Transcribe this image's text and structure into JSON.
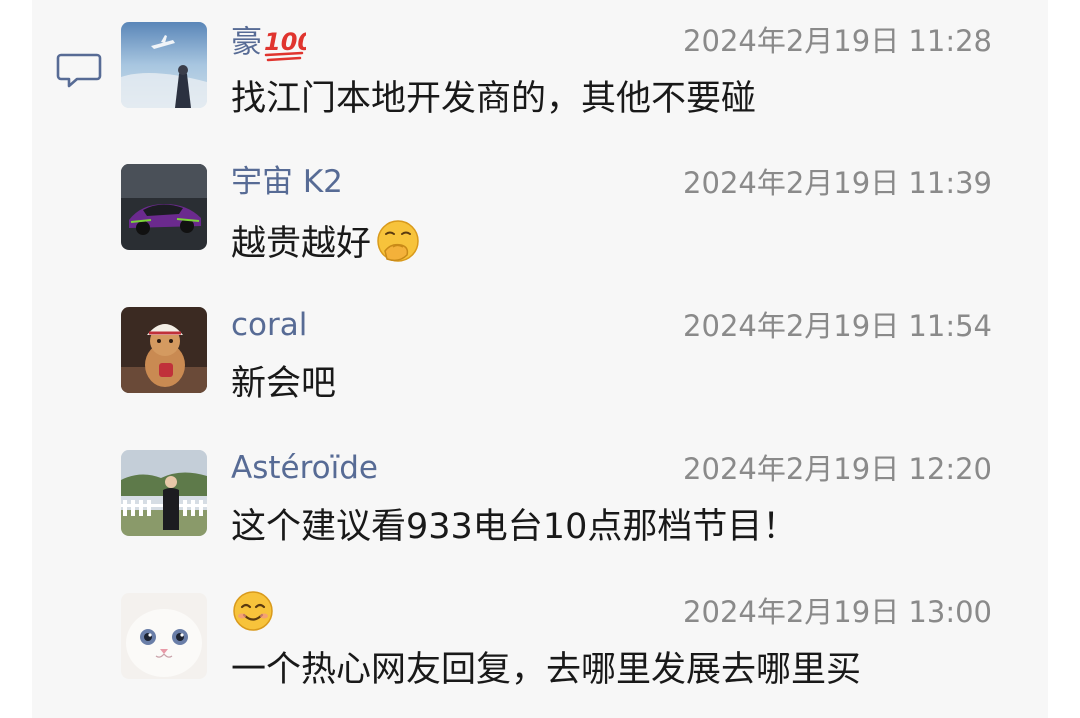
{
  "comments": [
    {
      "name": "豪",
      "name_emoji": "hundred-points-icon",
      "time": "2024年2月19日 11:28",
      "text": "找江门本地开发商的，其他不要碰",
      "avatar": "anime-sky-airplane-avatar"
    },
    {
      "name": "宇宙 K2",
      "time": "2024年2月19日 11:39",
      "text": "越贵越好",
      "text_emoji": "hand-over-mouth-face-icon",
      "avatar": "purple-sports-car-avatar"
    },
    {
      "name": "coral",
      "time": "2024年2月19日 11:54",
      "text": "新会吧",
      "avatar": "gingerbread-figure-avatar"
    },
    {
      "name": "Astéroïde",
      "time": "2024年2月19日 12:20",
      "text": "这个建议看933电台10点那档节目！",
      "avatar": "garden-fence-girl-avatar"
    },
    {
      "name": "",
      "name_emoji": "smiling-face-icon",
      "time": "2024年2月19日 13:00",
      "text": "一个热心网友回复，去哪里发展去哪里买",
      "avatar": "white-kitten-avatar"
    }
  ],
  "colors": {
    "name": "#576b95",
    "time": "#8a8a8a",
    "text": "#191919",
    "panel": "#f7f7f7"
  }
}
